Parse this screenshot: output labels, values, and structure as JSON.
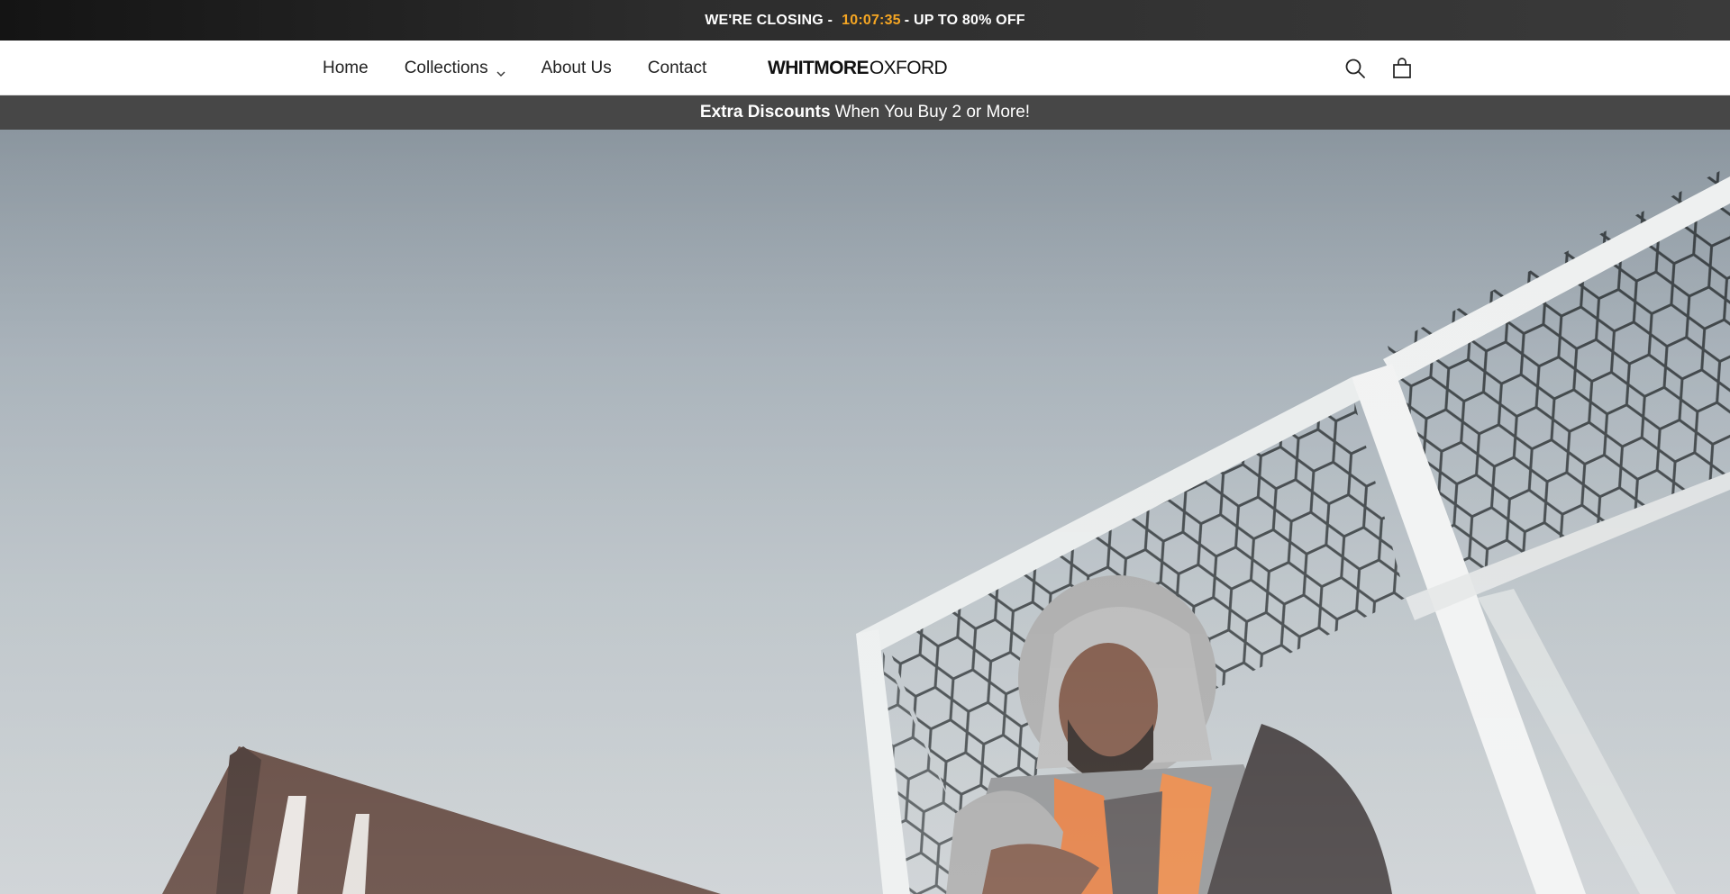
{
  "promo": {
    "prefix": "WE'RE CLOSING -",
    "timer": "10:07:35",
    "suffix": "- UP TO 80% OFF",
    "timer_color": "#f5a623"
  },
  "nav": {
    "items": [
      {
        "label": "Home",
        "has_dropdown": false
      },
      {
        "label": "Collections",
        "has_dropdown": true
      },
      {
        "label": "About Us",
        "has_dropdown": false
      },
      {
        "label": "Contact",
        "has_dropdown": false
      }
    ]
  },
  "logo": {
    "bold_part": "WHITMORE",
    "light_part": "OXFORD"
  },
  "header_icons": [
    "search-icon",
    "shopping-bag-icon"
  ],
  "discount": {
    "bold": "Extra Discounts",
    "rest": "When You Buy 2 or More!"
  },
  "hero": {
    "image": "man-in-hooded-orange-vest-sitting-by-soccer-goal"
  }
}
